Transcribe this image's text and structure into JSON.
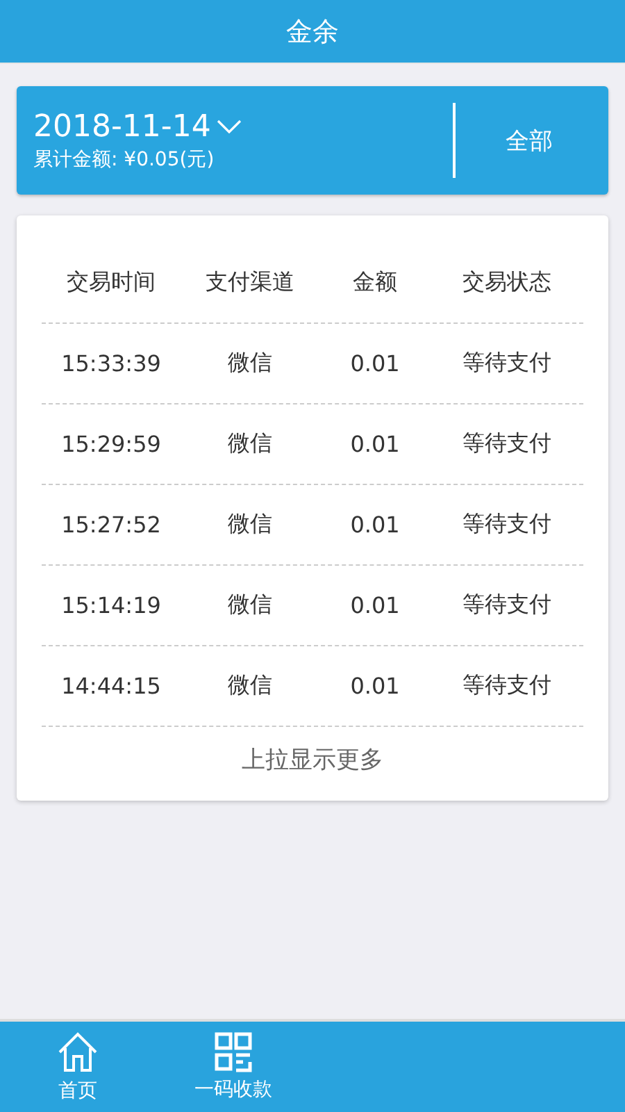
{
  "header": {
    "title": "金余"
  },
  "summary": {
    "date": "2018-11-14",
    "total": "累计金额: ¥0.05(元)",
    "filter": "全部"
  },
  "table": {
    "columns": [
      "交易时间",
      "支付渠道",
      "金额",
      "交易状态"
    ],
    "rows": [
      [
        "15:33:39",
        "微信",
        "0.01",
        "等待支付"
      ],
      [
        "15:29:59",
        "微信",
        "0.01",
        "等待支付"
      ],
      [
        "15:27:52",
        "微信",
        "0.01",
        "等待支付"
      ],
      [
        "15:14:19",
        "微信",
        "0.01",
        "等待支付"
      ],
      [
        "14:44:15",
        "微信",
        "0.01",
        "等待支付"
      ]
    ],
    "footer": "上拉显示更多"
  },
  "tab_bar": [
    {
      "kind": "home",
      "label": "首页"
    },
    {
      "kind": "qr",
      "label": "一码收款"
    }
  ]
}
